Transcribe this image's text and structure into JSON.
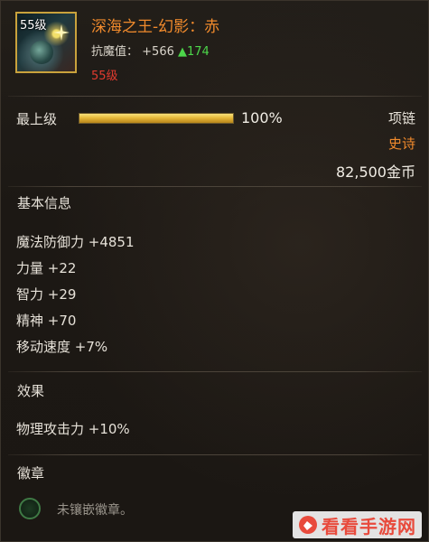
{
  "item": {
    "icon_level": "55级",
    "name": "深海之王-幻影：赤",
    "resist_label": "抗魔值：",
    "resist_value": "+566",
    "resist_bonus": "▲174",
    "level_req": "55级",
    "icon": "necklace-gem-icon"
  },
  "upgrade": {
    "label": "最上级",
    "progress": 1.0,
    "progress_text": "100%"
  },
  "meta": {
    "slot": "项链",
    "rarity": "史诗",
    "price": "82,500金币"
  },
  "basic_info": {
    "title": "基本信息",
    "stats": [
      "魔法防御力 +4851",
      "力量 +22",
      "智力 +29",
      "精神 +70",
      "移动速度 +7%"
    ]
  },
  "effects": {
    "title": "效果",
    "stats": [
      "物理攻击力 +10%"
    ]
  },
  "emblem": {
    "title": "徽章",
    "empty_text": "未镶嵌徽章。"
  },
  "watermark": {
    "text": "看看手游网"
  },
  "colors": {
    "name": "#f08a2c",
    "rarity": "#f08a2c",
    "level_req": "#e23b2f",
    "bonus": "#4cd64a",
    "progress_fill": "#e7b93a"
  }
}
